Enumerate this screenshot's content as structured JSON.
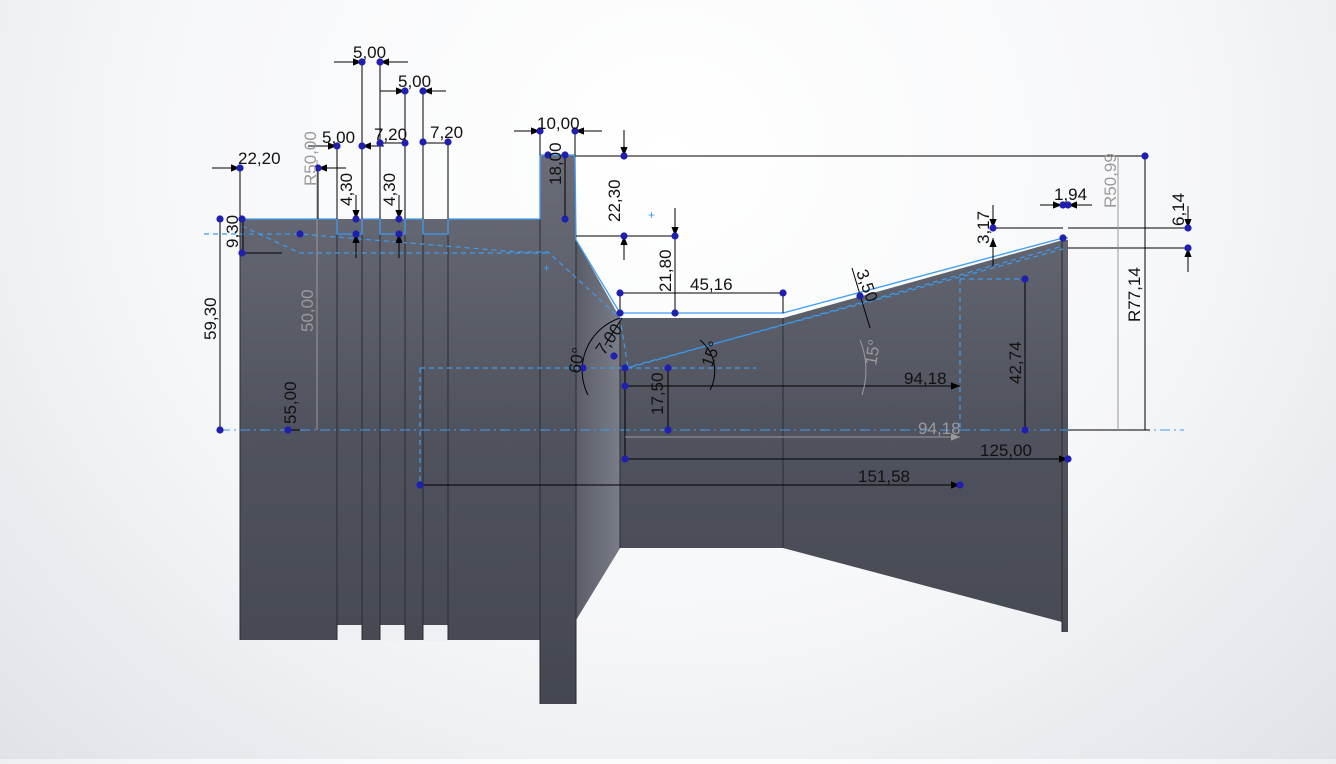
{
  "title": "",
  "colors": {
    "background": "#f2f3f5",
    "part_fill": "#565964",
    "sketch_line": "#3c9cf2",
    "dimension_text": "#111111",
    "driven_dimension_text": "#9a9a9a",
    "point": "#1f1fb0"
  },
  "dimensions": {
    "top_5_00_a": "5,00",
    "top_5_00_b": "5,00",
    "groove_5_00": "5,00",
    "w_7_20_a": "7,20",
    "w_7_20_b": "7,20",
    "w_22_20": "22,20",
    "r_50_00": "R50,00",
    "h_4_30_a": "4,30",
    "h_4_30_b": "4,30",
    "h_9_30": "9,30",
    "h_59_30": "59,30",
    "h_50_00_grey": "50,00",
    "h_55_00": "55,00",
    "w_10_00": "10,00",
    "h_18_00": "18,00",
    "h_22_30": "22,30",
    "h_21_80": "21,80",
    "w_45_16": "45,16",
    "ang_60": "60°",
    "r_7_00": "7,00",
    "ang_15": "15°",
    "ang_15_grey": "15°",
    "h_17_50": "17,50",
    "w_94_18": "94,18",
    "w_94_18_grey": "94,18",
    "w_151_58": "151,58",
    "w_125_00": "125,00",
    "t_3_50": "3,50",
    "h_42_74": "42,74",
    "w_1_94": "1,94",
    "h_3_17": "3,17",
    "h_6_14": "6,14",
    "r_50_99": "R50,99",
    "r_77_14": "R77,14"
  }
}
